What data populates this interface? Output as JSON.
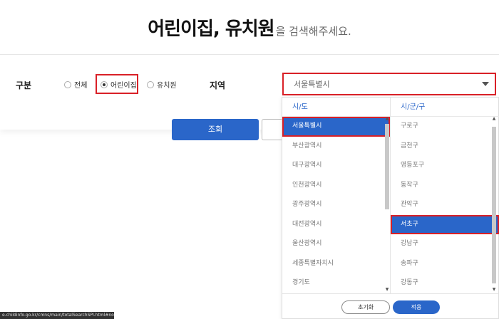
{
  "headline": {
    "strong": "어린이집, 유치원",
    "light": "을 검색해주세요."
  },
  "filter": {
    "type_label": "구분",
    "options": [
      {
        "label": "전체",
        "checked": false
      },
      {
        "label": "어린이집",
        "checked": true
      },
      {
        "label": "유치원",
        "checked": false
      }
    ],
    "region_label": "지역",
    "region_value": "서울특별시"
  },
  "buttons": {
    "search": "조회",
    "reset": "초기화",
    "apply": "적용"
  },
  "dropdown": {
    "left_header": "시/도",
    "right_header": "시/군/구",
    "provinces": [
      "서울특별시",
      "부산광역시",
      "대구광역시",
      "인천광역시",
      "광주광역시",
      "대전광역시",
      "울산광역시",
      "세종특별자치시",
      "경기도"
    ],
    "selected_province": "서울특별시",
    "districts": [
      "구로구",
      "금천구",
      "영등포구",
      "동작구",
      "관악구",
      "서초구",
      "강남구",
      "송파구",
      "강동구"
    ],
    "selected_district": "서초구"
  },
  "statusbar": {
    "url": "e.childinfo.go.kr/cmns/main/totalSearchSPI.html#none"
  },
  "colors": {
    "accent": "#2a66c9",
    "highlight": "#d92027"
  }
}
